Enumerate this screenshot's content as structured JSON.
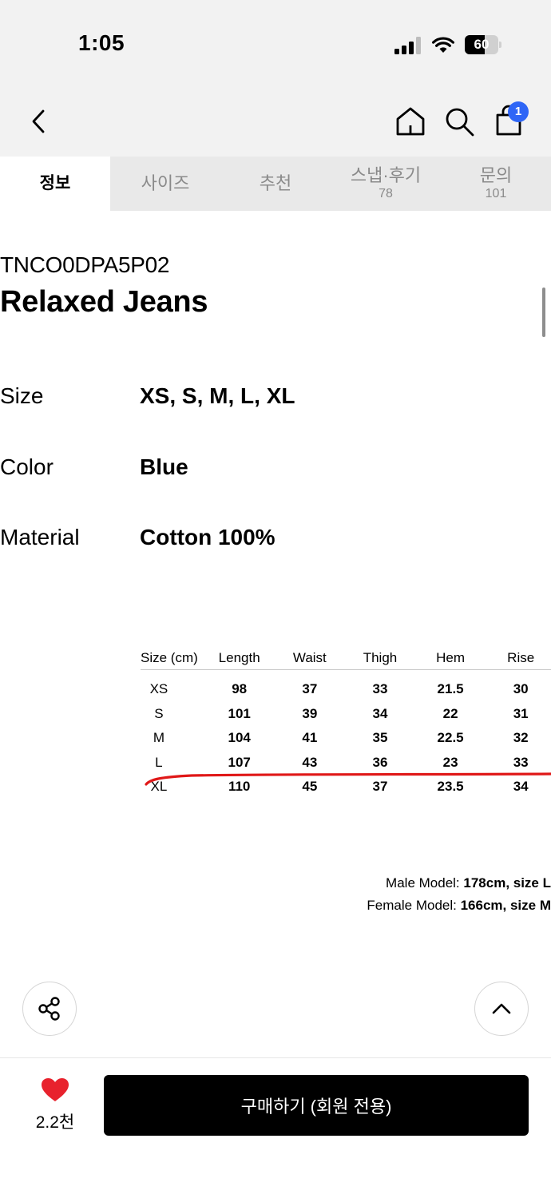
{
  "status_bar": {
    "time": "1:05",
    "battery_percent": "60"
  },
  "nav": {
    "cart_count": "1"
  },
  "tabs": [
    {
      "label": "정보",
      "count": ""
    },
    {
      "label": "사이즈",
      "count": ""
    },
    {
      "label": "추천",
      "count": ""
    },
    {
      "label": "스냅·후기",
      "count": "78"
    },
    {
      "label": "문의",
      "count": "101"
    }
  ],
  "product": {
    "code": "TNCO0DPA5P02",
    "name": "Relaxed Jeans",
    "specs": [
      {
        "key": "Size",
        "value": "XS, S, M, L, XL"
      },
      {
        "key": "Color",
        "value": "Blue"
      },
      {
        "key": "Material",
        "value": "Cotton 100%"
      }
    ]
  },
  "size_table": {
    "headers": [
      "Size (cm)",
      "Length",
      "Waist",
      "Thigh",
      "Hem",
      "Rise"
    ],
    "rows": [
      [
        "XS",
        "98",
        "37",
        "33",
        "21.5",
        "30"
      ],
      [
        "S",
        "101",
        "39",
        "34",
        "22",
        "31"
      ],
      [
        "M",
        "104",
        "41",
        "35",
        "22.5",
        "32"
      ],
      [
        "L",
        "107",
        "43",
        "36",
        "23",
        "33"
      ],
      [
        "XL",
        "110",
        "45",
        "37",
        "23.5",
        "34"
      ]
    ]
  },
  "models": {
    "male_label": "Male Model: ",
    "male_height": "178cm",
    "male_size": ", size L",
    "female_label": "Female Model: ",
    "female_height": "166cm",
    "female_size": ", size M"
  },
  "bottom": {
    "like_count": "2.2천",
    "buy_label": "구매하기 (회원 전용)"
  },
  "colors": {
    "accent_badge": "#2f66f6",
    "heart": "#e8222d",
    "annotation_line": "#e01818"
  }
}
